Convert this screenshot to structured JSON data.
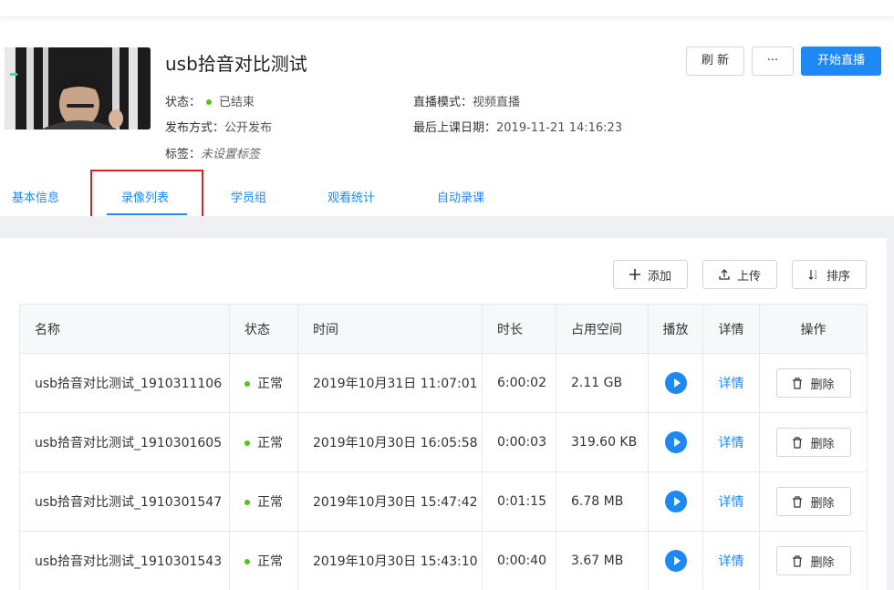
{
  "course": {
    "title": "usb拾音对比测试",
    "status_label": "状态：",
    "status_value": "已结束",
    "publish_label": "发布方式：",
    "publish_value": "公开发布",
    "tags_label": "标签：",
    "tags_value": "未设置标签",
    "mode_label": "直播模式：",
    "mode_value": "视频直播",
    "last_date_label": "最后上课日期：",
    "last_date_value": "2019-11-21 14:16:23"
  },
  "actions": {
    "refresh": "刷 新",
    "more": "···",
    "start_live": "开始直播"
  },
  "tabs": [
    "基本信息",
    "录像列表",
    "学员组",
    "观看统计",
    "自动录课"
  ],
  "active_tab": "录像列表",
  "toolbar": {
    "add": "添加",
    "upload": "上传",
    "sort": "排序"
  },
  "table": {
    "headers": [
      "名称",
      "状态",
      "时间",
      "时长",
      "占用空间",
      "播放",
      "详情",
      "操作"
    ],
    "rows": [
      {
        "name": "usb拾音对比测试_1910311106",
        "status": "正常",
        "time": "2019年10月31日 11:07:01",
        "duration": "6:00:02",
        "size": "2.11 GB",
        "detail": "详情",
        "delete": "删除"
      },
      {
        "name": "usb拾音对比测试_1910301605",
        "status": "正常",
        "time": "2019年10月30日 16:05:58",
        "duration": "0:00:03",
        "size": "319.60 KB",
        "detail": "详情",
        "delete": "删除"
      },
      {
        "name": "usb拾音对比测试_1910301547",
        "status": "正常",
        "time": "2019年10月30日 15:47:42",
        "duration": "0:01:15",
        "size": "6.78 MB",
        "detail": "详情",
        "delete": "删除"
      },
      {
        "name": "usb拾音对比测试_1910301543",
        "status": "正常",
        "time": "2019年10月30日 15:43:10",
        "duration": "0:00:40",
        "size": "3.67 MB",
        "detail": "详情",
        "delete": "删除"
      }
    ]
  },
  "colors": {
    "accent": "#1e88f5",
    "status_green": "#52c41a",
    "highlight_red": "#e02020"
  }
}
